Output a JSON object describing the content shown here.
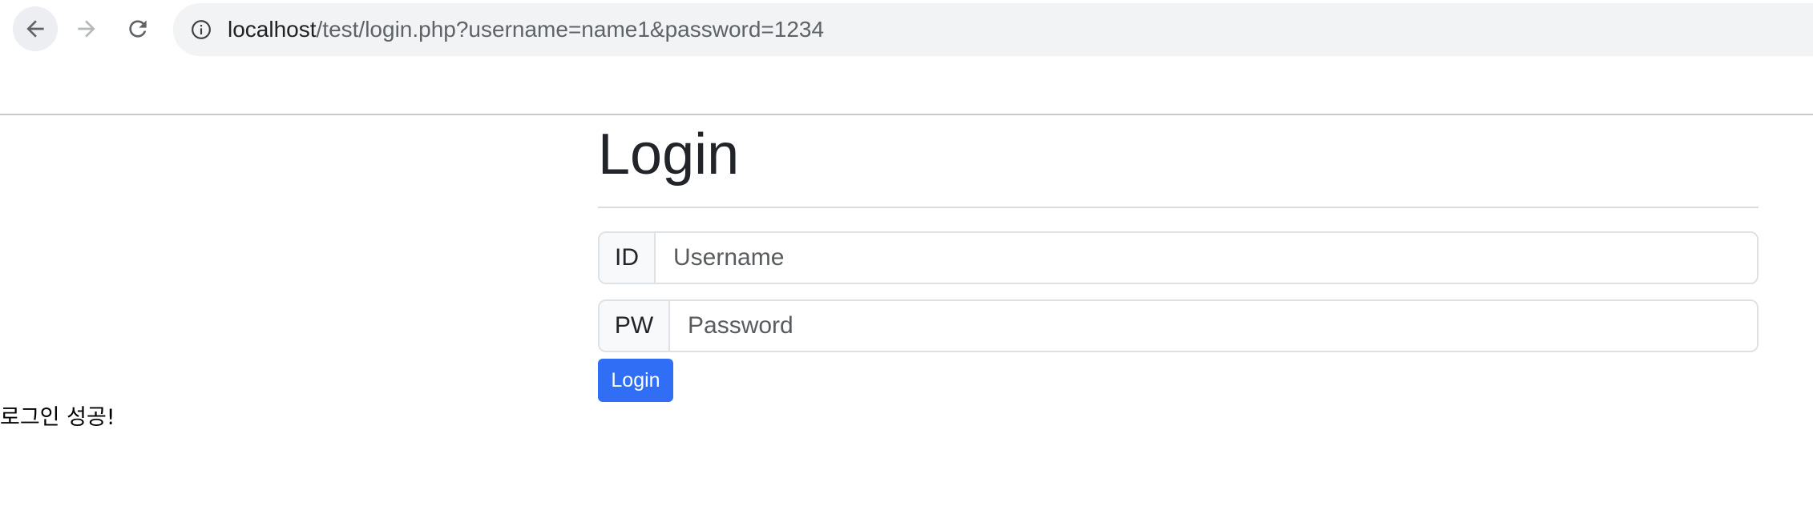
{
  "browser": {
    "url_host": "localhost",
    "url_path": "/test/login.php?username=name1&password=1234",
    "icons": {
      "back": "arrow-left-icon",
      "forward": "arrow-right-icon",
      "reload": "reload-icon",
      "site_info": "info-icon"
    }
  },
  "page": {
    "title": "Login",
    "id_label": "ID",
    "id_placeholder": "Username",
    "id_value": "",
    "pw_label": "PW",
    "pw_placeholder": "Password",
    "pw_value": "",
    "login_button": "Login",
    "result_message": "로그인 성공!"
  },
  "colors": {
    "primary_button": "#2f6ef5",
    "omnibox_bg": "#f1f3f4"
  }
}
